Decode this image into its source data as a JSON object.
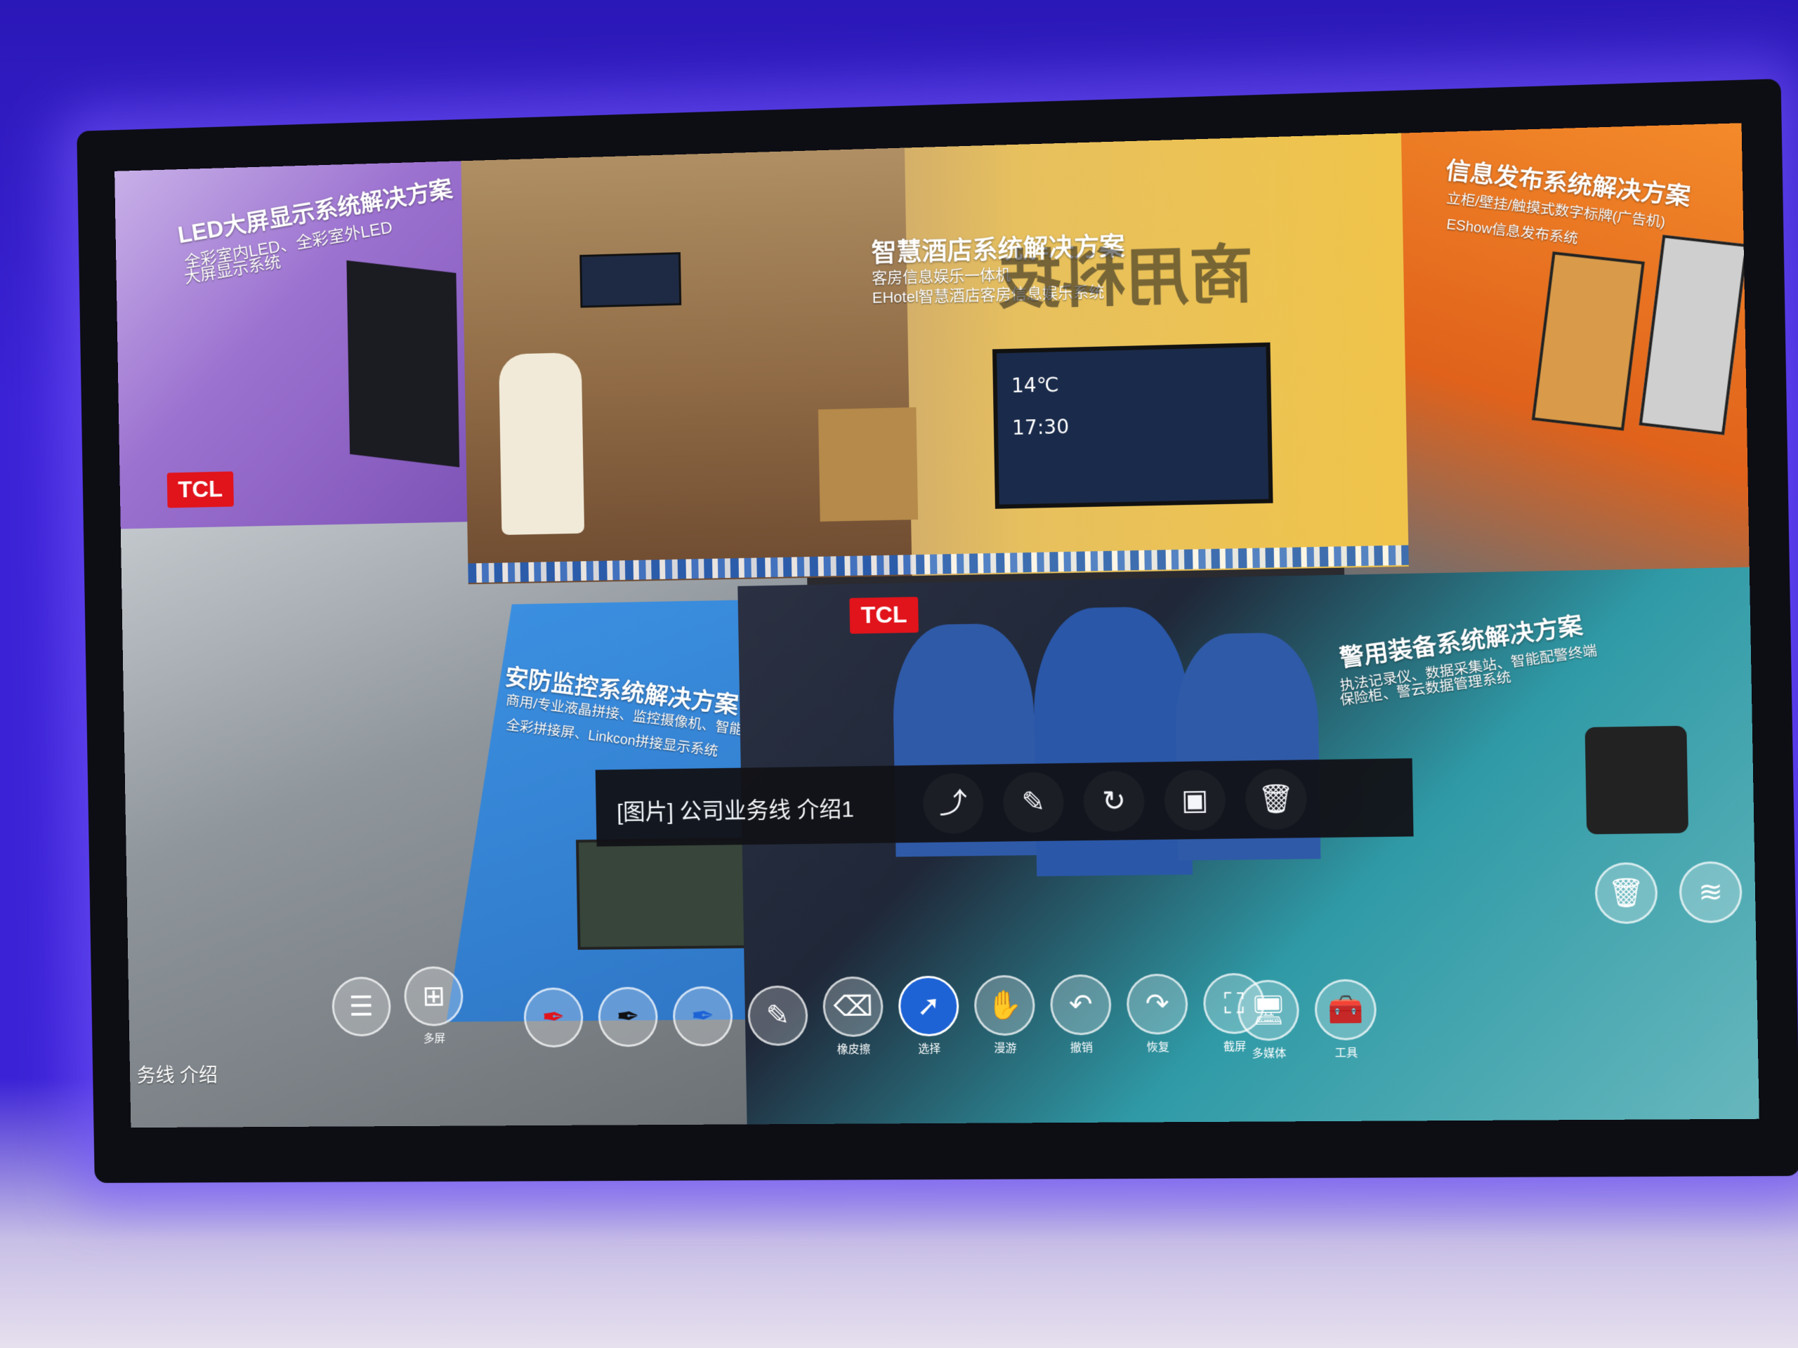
{
  "heading": "商用科技",
  "tiles": {
    "led": {
      "title": "LED大屏显示系统解决方案",
      "sub": [
        "全彩室内LED、全彩室外LED",
        "大屏显示系统"
      ]
    },
    "hotel": {
      "title": "智慧酒店系统解决方案",
      "sub": [
        "客房信息娱乐一体机",
        "EHotel智慧酒店客房信息娱乐系统"
      ],
      "tv_temp": "14℃",
      "tv_time": "17:30"
    },
    "info": {
      "title": "信息发布系统解决方案",
      "sub": [
        "立柜/壁挂/触摸式数字标牌(广告机)",
        "EShow信息发布系统"
      ]
    },
    "security": {
      "title": "安防监控系统解决方案",
      "sub": [
        "商用/专业液晶拼接、监控摄像机、智能门禁",
        "全彩拼接屏、Linkcon拼接显示系统"
      ]
    },
    "police": {
      "title": "警用装备系统解决方案",
      "sub": [
        "执法记录仪、数据采集站、智能配警终端",
        "保险柜、警云数据管理系统"
      ]
    }
  },
  "brand": "TCL",
  "caption": {
    "label": "[图片] 公司业务线 介绍1",
    "actions": [
      "share-icon",
      "edit-icon",
      "rotate-icon",
      "save-icon",
      "trash-icon"
    ]
  },
  "toolbar": {
    "left": [
      "document-icon",
      "windows-icon"
    ],
    "left_label": "多屏",
    "tools": [
      {
        "icon": "red-pen-icon",
        "label": ""
      },
      {
        "icon": "black-pen-icon",
        "label": ""
      },
      {
        "icon": "blue-pen-icon",
        "label": ""
      },
      {
        "icon": "pen-icon",
        "label": ""
      },
      {
        "icon": "eraser-icon",
        "label": "橡皮擦"
      },
      {
        "icon": "cursor-icon",
        "label": "选择"
      },
      {
        "icon": "hand-icon",
        "label": "漫游"
      },
      {
        "icon": "undo-icon",
        "label": "撤销"
      },
      {
        "icon": "redo-icon",
        "label": "恢复"
      },
      {
        "icon": "screenshot-icon",
        "label": "截屏"
      },
      {
        "icon": "monitor-icon",
        "label": "多媒体"
      },
      {
        "icon": "toolbox-icon",
        "label": "工具"
      }
    ]
  },
  "right_icons": [
    "trash-icon",
    "layers-icon"
  ],
  "left_bottom_text": "务线 介绍"
}
